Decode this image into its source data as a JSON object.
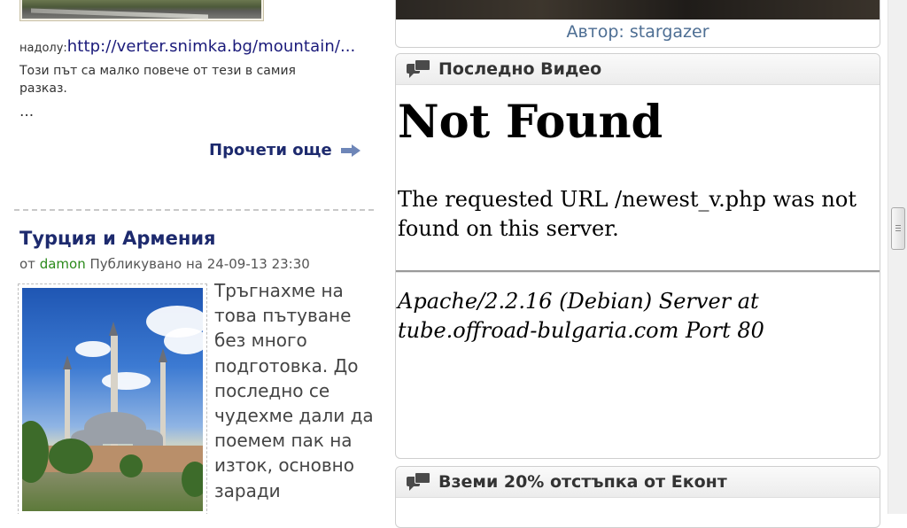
{
  "left": {
    "link_prefix": "надолу:",
    "link_url": "http://verter.snimka.bg/mountain/",
    "link_url_tail": "...",
    "paragraph": "Този път са малко повече от тези в самия разказ.",
    "ellipsis": "...",
    "read_more": "Прочети още",
    "post": {
      "title": "Турция и Армения",
      "meta_from": "от",
      "author": "damon",
      "meta_published": "Публикувано на 24-09-13 23:30",
      "body": "Тръгнахме на това пътуване без много подготовка. До последно се чудехме дали да поемем пак на изток, основно заради"
    }
  },
  "right": {
    "top_caption": "Автор: stargazer",
    "video_widget": {
      "title": "Последно Видео",
      "error_title": "Not Found",
      "error_message": "The requested URL /newest_v.php was not found on this server.",
      "server_line": "Apache/2.2.16 (Debian) Server at tube.offroad-bulgaria.com Port 80"
    },
    "econt_widget": {
      "title": "Вземи 20% отстъпка от Еконт"
    }
  },
  "colors": {
    "title_navy": "#1d2a6e",
    "author_green": "#2a8a1a",
    "caption_blue": "#4d6e93"
  },
  "icons": [
    "chat-bubbles-icon",
    "arrow-right-icon"
  ]
}
